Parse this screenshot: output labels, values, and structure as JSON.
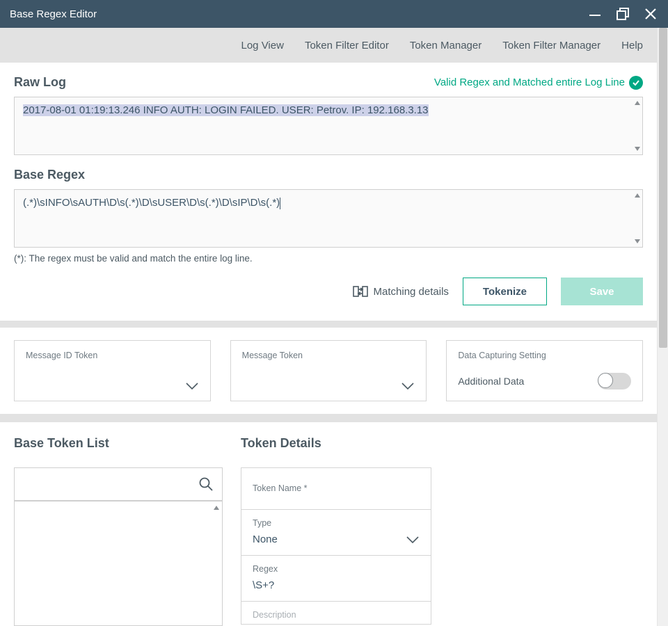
{
  "window": {
    "title": "Base Regex Editor"
  },
  "menu": {
    "log_view": "Log View",
    "token_filter_editor": "Token Filter Editor",
    "token_manager": "Token Manager",
    "token_filter_manager": "Token Filter Manager",
    "help": "Help"
  },
  "raw_log": {
    "heading": "Raw Log",
    "status": "Valid Regex and Matched entire Log Line",
    "value": "2017-08-01 01:19:13.246 INFO AUTH: LOGIN FAILED. USER: Petrov. IP: 192.168.3.13"
  },
  "base_regex": {
    "heading": "Base Regex",
    "value": "(.*)\\sINFO\\sAUTH\\D\\s(.*)\\D\\sUSER\\D\\s(.*)\\D\\sIP\\D\\s(.*)",
    "hint": "(*): The regex must be valid and match the entire log line."
  },
  "actions": {
    "matching": "Matching details",
    "tokenize": "Tokenize",
    "save": "Save"
  },
  "token_row": {
    "msg_id": "Message ID Token",
    "msg": "Message Token",
    "capture_heading": "Data Capturing Setting",
    "additional": "Additional Data"
  },
  "lower": {
    "list_heading": "Base Token List",
    "details_heading": "Token Details",
    "fields": {
      "name_label": "Token Name *",
      "type_label": "Type",
      "type_value": "None",
      "regex_label": "Regex",
      "regex_value": "\\S+?",
      "desc_label": "Description"
    }
  }
}
